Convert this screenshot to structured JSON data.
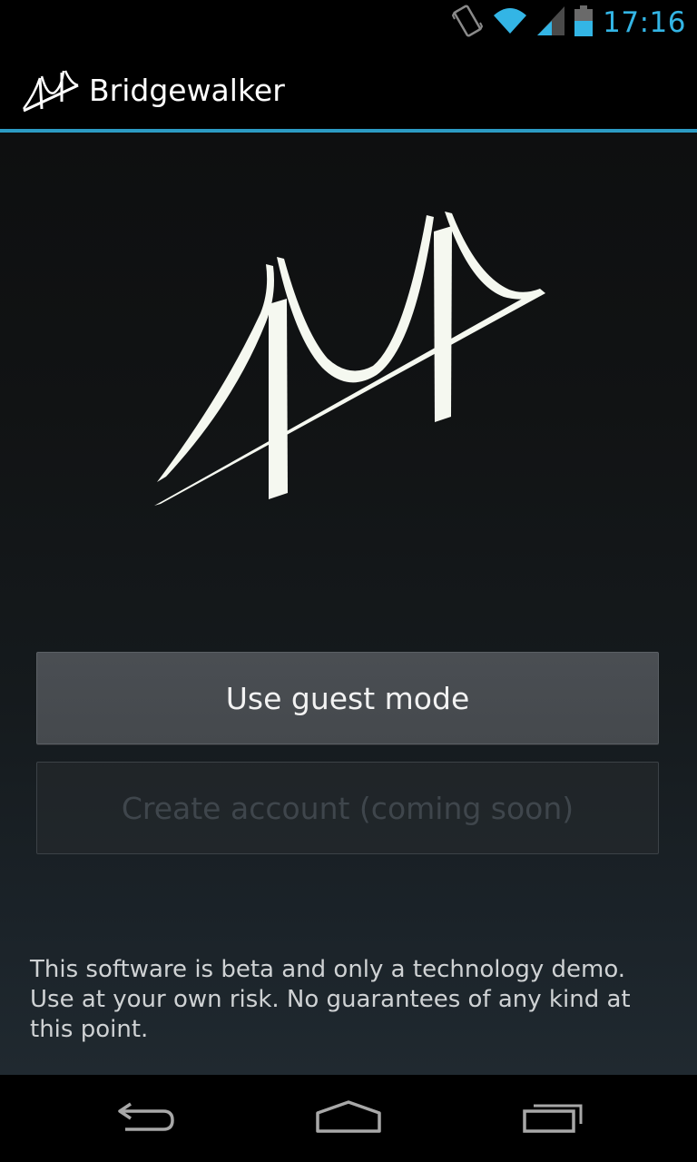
{
  "status_bar": {
    "time": "17:16",
    "icons": [
      "vibrate-icon",
      "wifi-icon",
      "cell-signal-icon",
      "battery-icon"
    ],
    "accent_color": "#33b5e5"
  },
  "action_bar": {
    "title": "Bridgewalker",
    "icon": "bridge-logo-icon",
    "divider_color": "#33b5e5"
  },
  "main": {
    "logo": "bridge-logo",
    "guest_button_label": "Use guest mode",
    "create_account_label": "Create account (coming soon)",
    "disclaimer": "This software is beta and only a technology demo. Use at your own risk. No guarantees of any kind at this point."
  },
  "nav_bar": {
    "back": "back-icon",
    "home": "home-icon",
    "recents": "recents-icon"
  }
}
